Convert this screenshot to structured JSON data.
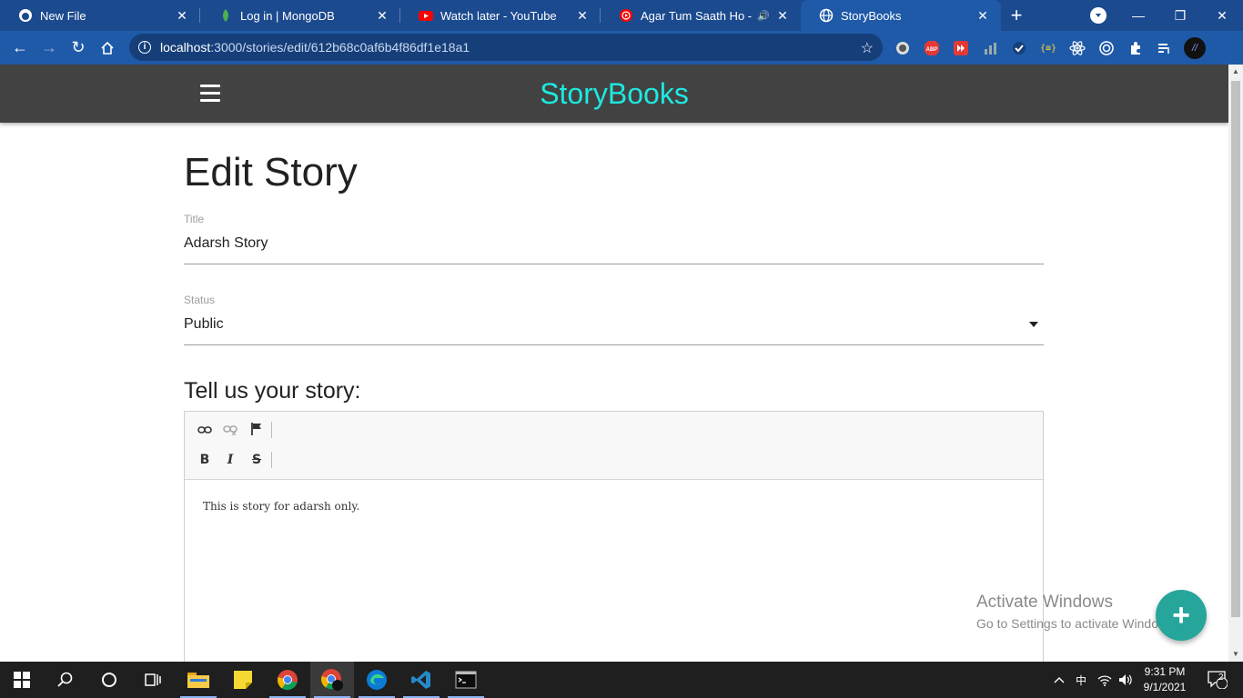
{
  "browser": {
    "tabs": [
      {
        "title": "New File",
        "icon": "github-icon",
        "active": false
      },
      {
        "title": "Log in | MongoDB",
        "icon": "mongodb-leaf-icon",
        "active": false
      },
      {
        "title": "Watch later - YouTube",
        "icon": "youtube-icon",
        "active": false
      },
      {
        "title": "Agar Tum Saath Ho - You",
        "icon": "youtube-music-icon",
        "active": false,
        "audio": true
      },
      {
        "title": "StoryBooks",
        "icon": "globe-icon",
        "active": true
      }
    ],
    "url_host": "localhost",
    "url_path": ":3000/stories/edit/612b68c0af6b4f86df1e18a1",
    "extensions": [
      "block-icon",
      "adblock-plus-icon",
      "video-speed-icon",
      "chart-icon",
      "check-icon",
      "json-icon",
      "react-devtools-icon",
      "target-icon",
      "extensions-icon",
      "media-queue-icon",
      "profile-avatar"
    ]
  },
  "site": {
    "brand": "StoryBooks",
    "page_title": "Edit Story",
    "title_label": "Title",
    "title_value": "Adarsh Story",
    "status_label": "Status",
    "status_value": "Public",
    "story_heading": "Tell us your story:",
    "story_body": "This is story for adarsh only.",
    "fab_label": "+"
  },
  "watermark": {
    "line1": "Activate Windows",
    "line2": "Go to Settings to activate Windows."
  },
  "taskbar": {
    "time": "9:31 PM",
    "date": "9/1/2021",
    "notifications": "2",
    "input_indicator": "中",
    "colors": {
      "background": "#1f1f1f",
      "running_underline": "#8ab4f8"
    }
  },
  "colors": {
    "tab_strip": "#1b4a8f",
    "toolbar": "#1f5aa8",
    "site_nav": "#424242",
    "brand": "#1de9e0",
    "fab": "#26a69a"
  }
}
